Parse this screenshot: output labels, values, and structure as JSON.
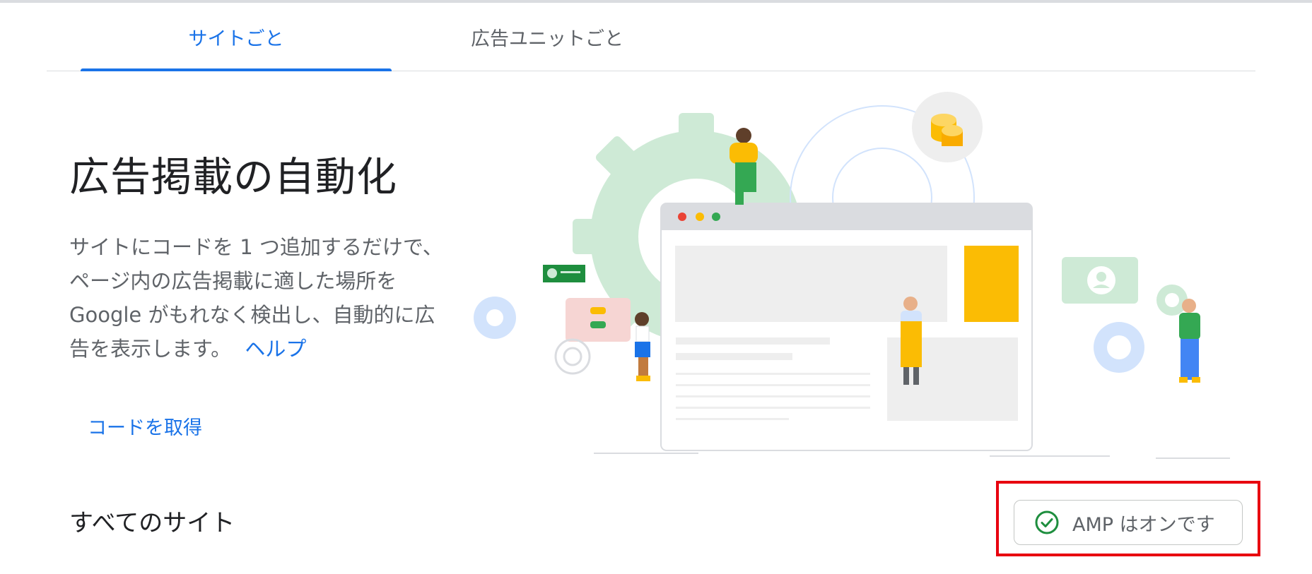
{
  "tabs": [
    {
      "label": "サイトごと",
      "active": true
    },
    {
      "label": "広告ユニットごと",
      "active": false
    }
  ],
  "main": {
    "title": "広告掲載の自動化",
    "description": "サイトにコードを 1 つ追加するだけで、ページ内の広告掲載に適した場所を Google がもれなく検出し、自動的に広告を表示します。",
    "help_link": "ヘルプ",
    "get_code": "コードを取得"
  },
  "sites": {
    "heading": "すべてのサイト",
    "amp_status": "AMP はオンです",
    "amp_icon": "check-circle-icon"
  },
  "colors": {
    "accent": "#1a73e8",
    "success": "#1e8e3e",
    "highlight": "#e8000f"
  }
}
